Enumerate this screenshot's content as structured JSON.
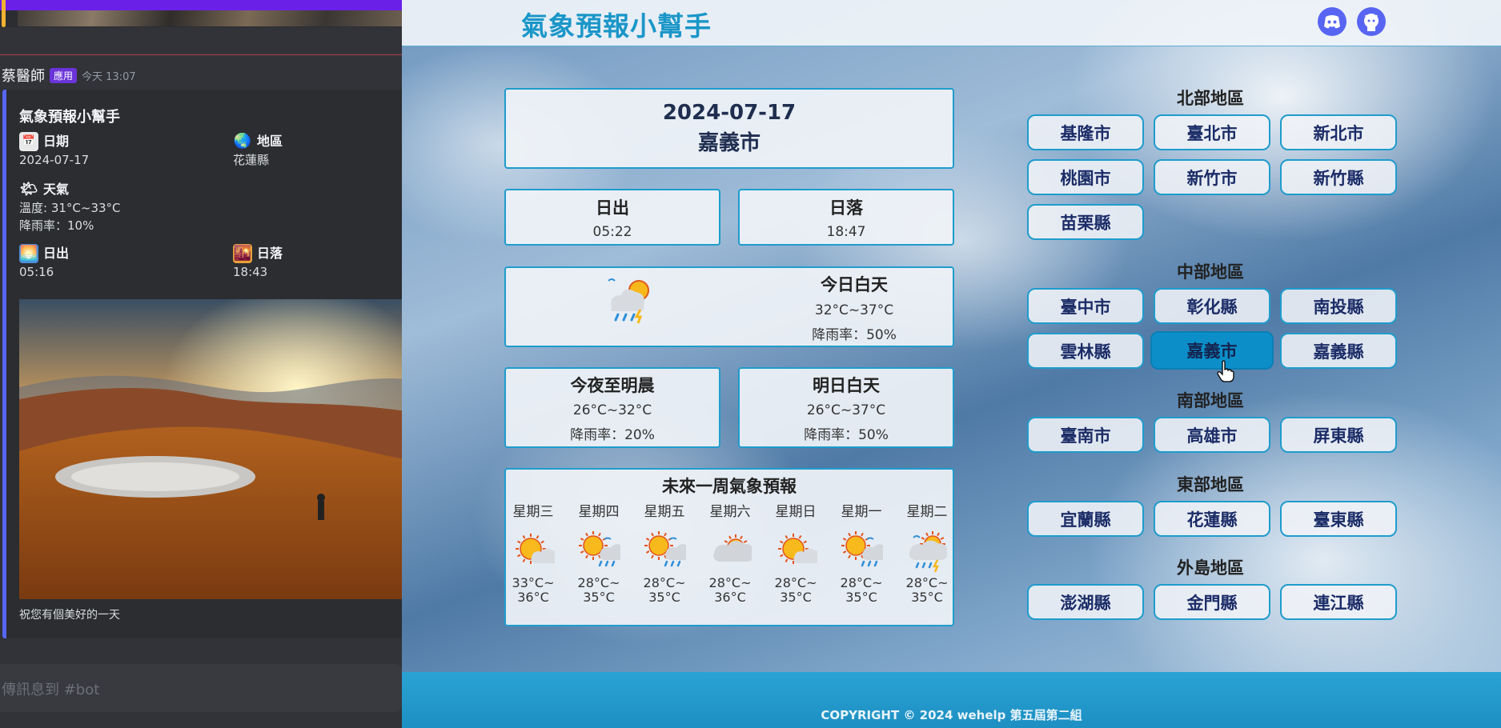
{
  "discord": {
    "author": "蔡醫師",
    "app_tag": "應用",
    "timestamp": "今天 13:07",
    "embed": {
      "title": "氣象預報小幫手",
      "date_label": "日期",
      "date_value": "2024-07-17",
      "region_label": "地區",
      "region_value": "花蓮縣",
      "weather_label": "天氣",
      "temp_text": "溫度: 31°C~33°C",
      "rain_text": "降雨率：10%",
      "sunrise_label": "日出",
      "sunrise_value": "05:16",
      "sunset_label": "日落",
      "sunset_value": "18:43",
      "footer": "祝您有個美好的一天"
    },
    "input_placeholder": "傳訊息到 #bot"
  },
  "app": {
    "brand": "氣象預報小幫手",
    "date": "2024-07-17",
    "city": "嘉義市",
    "sunrise": {
      "label": "日出",
      "time": "05:22"
    },
    "sunset": {
      "label": "日落",
      "time": "18:47"
    },
    "today": {
      "label": "今日白天",
      "temp": "32°C~37°C",
      "rain": "降雨率：50%",
      "icon": "rain-thunder-sun-icon"
    },
    "tonight": {
      "label": "今夜至明晨",
      "temp": "26°C~32°C",
      "rain": "降雨率：20%"
    },
    "tomorrow": {
      "label": "明日白天",
      "temp": "26°C~37°C",
      "rain": "降雨率：50%"
    },
    "week": {
      "title": "未來一周氣象預報",
      "days": [
        {
          "day": "星期三",
          "t1": "33°C~",
          "t2": "36°C",
          "icon": "sunny-icon"
        },
        {
          "day": "星期四",
          "t1": "28°C~",
          "t2": "35°C",
          "icon": "sun-shower-icon"
        },
        {
          "day": "星期五",
          "t1": "28°C~",
          "t2": "35°C",
          "icon": "sun-shower-icon"
        },
        {
          "day": "星期六",
          "t1": "28°C~",
          "t2": "36°C",
          "icon": "cloudy-icon"
        },
        {
          "day": "星期日",
          "t1": "28°C~",
          "t2": "35°C",
          "icon": "sunny-icon"
        },
        {
          "day": "星期一",
          "t1": "28°C~",
          "t2": "35°C",
          "icon": "sun-shower-icon"
        },
        {
          "day": "星期二",
          "t1": "28°C~",
          "t2": "35°C",
          "icon": "rain-thunder-sun-icon"
        }
      ]
    },
    "regions": [
      {
        "title": "北部地區",
        "cities": [
          "基隆市",
          "臺北市",
          "新北市",
          "桃園市",
          "新竹市",
          "新竹縣",
          "苗栗縣"
        ]
      },
      {
        "title": "中部地區",
        "cities": [
          "臺中市",
          "彰化縣",
          "南投縣",
          "雲林縣",
          "嘉義市",
          "嘉義縣"
        ]
      },
      {
        "title": "南部地區",
        "cities": [
          "臺南市",
          "高雄市",
          "屏東縣"
        ]
      },
      {
        "title": "東部地區",
        "cities": [
          "宜蘭縣",
          "花蓮縣",
          "臺東縣"
        ]
      },
      {
        "title": "外島地區",
        "cities": [
          "澎湖縣",
          "金門縣",
          "連江縣"
        ]
      }
    ],
    "active_city": "嘉義市",
    "footer": "COPYRIGHT © 2024 wehelp 第五屆第二組",
    "colors": {
      "accent": "#1f9ccc",
      "brand": "#1a96c8",
      "active": "#0c8fc9",
      "discord_blurple": "#5865f2"
    }
  }
}
